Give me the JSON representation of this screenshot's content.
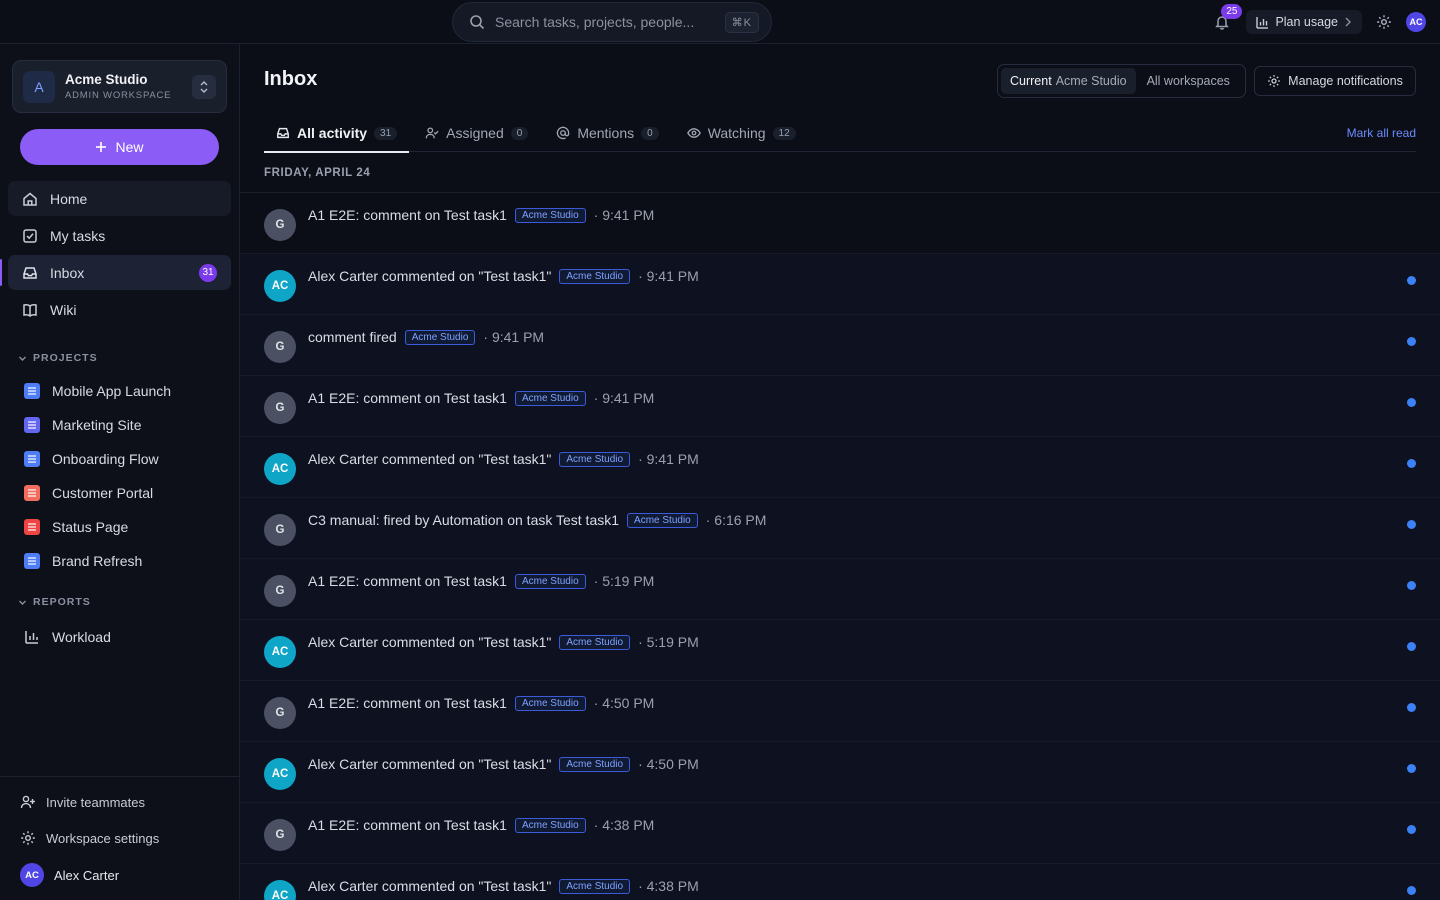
{
  "topbar": {
    "search_placeholder": "Search tasks, projects, people...",
    "search_shortcut": "⌘K",
    "notifications_count": "25",
    "plan_usage_label": "Plan usage",
    "user_initials": "AC"
  },
  "sidebar": {
    "workspace": {
      "initial": "A",
      "name": "Acme Studio",
      "role": "ADMIN WORKSPACE"
    },
    "new_label": "New",
    "nav": [
      {
        "label": "Home",
        "icon": "home-icon"
      },
      {
        "label": "My tasks",
        "icon": "checkbox-icon"
      },
      {
        "label": "Inbox",
        "icon": "inbox-icon",
        "badge": "31"
      },
      {
        "label": "Wiki",
        "icon": "book-icon"
      }
    ],
    "projects_header": "PROJECTS",
    "projects": [
      {
        "label": "Mobile App Launch",
        "color": "#4f7cf7"
      },
      {
        "label": "Marketing Site",
        "color": "#6366f1"
      },
      {
        "label": "Onboarding Flow",
        "color": "#4f7cf7"
      },
      {
        "label": "Customer Portal",
        "color": "#f26d5b"
      },
      {
        "label": "Status Page",
        "color": "#ef4444"
      },
      {
        "label": "Brand Refresh",
        "color": "#4f7cf7"
      }
    ],
    "reports_header": "REPORTS",
    "reports": [
      {
        "label": "Workload"
      }
    ],
    "invite_label": "Invite teammates",
    "settings_label": "Workspace settings",
    "user": {
      "initials": "AC",
      "name": "Alex Carter"
    }
  },
  "main": {
    "title": "Inbox",
    "scope": {
      "current_label": "Current",
      "current_ws": "Acme Studio",
      "all_label": "All workspaces"
    },
    "manage_label": "Manage notifications",
    "tabs": [
      {
        "label": "All activity",
        "count": "31"
      },
      {
        "label": "Assigned",
        "count": "0"
      },
      {
        "label": "Mentions",
        "count": "0"
      },
      {
        "label": "Watching",
        "count": "12"
      }
    ],
    "mark_all_read": "Mark all read",
    "date_header": "FRIDAY, APRIL 24",
    "notifications": [
      {
        "avatar": "G",
        "kind": "g",
        "text": "A1 E2E: comment on Test task1",
        "workspace": "Acme Studio",
        "time": "· 9:41 PM",
        "unread": false
      },
      {
        "avatar": "AC",
        "kind": "ac",
        "text": "Alex Carter commented on \"Test task1\"",
        "workspace": "Acme Studio",
        "time": "· 9:41 PM",
        "unread": true
      },
      {
        "avatar": "G",
        "kind": "g",
        "text": "comment fired",
        "workspace": "Acme Studio",
        "time": "· 9:41 PM",
        "unread": true
      },
      {
        "avatar": "G",
        "kind": "g",
        "text": "A1 E2E: comment on Test task1",
        "workspace": "Acme Studio",
        "time": "· 9:41 PM",
        "unread": true
      },
      {
        "avatar": "AC",
        "kind": "ac",
        "text": "Alex Carter commented on \"Test task1\"",
        "workspace": "Acme Studio",
        "time": "· 9:41 PM",
        "unread": true
      },
      {
        "avatar": "G",
        "kind": "g",
        "text": "C3 manual: fired by Automation on task Test task1",
        "workspace": "Acme Studio",
        "time": "· 6:16 PM",
        "unread": true
      },
      {
        "avatar": "G",
        "kind": "g",
        "text": "A1 E2E: comment on Test task1",
        "workspace": "Acme Studio",
        "time": "· 5:19 PM",
        "unread": true
      },
      {
        "avatar": "AC",
        "kind": "ac",
        "text": "Alex Carter commented on \"Test task1\"",
        "workspace": "Acme Studio",
        "time": "· 5:19 PM",
        "unread": true
      },
      {
        "avatar": "G",
        "kind": "g",
        "text": "A1 E2E: comment on Test task1",
        "workspace": "Acme Studio",
        "time": "· 4:50 PM",
        "unread": true
      },
      {
        "avatar": "AC",
        "kind": "ac",
        "text": "Alex Carter commented on \"Test task1\"",
        "workspace": "Acme Studio",
        "time": "· 4:50 PM",
        "unread": true
      },
      {
        "avatar": "G",
        "kind": "g",
        "text": "A1 E2E: comment on Test task1",
        "workspace": "Acme Studio",
        "time": "· 4:38 PM",
        "unread": true
      },
      {
        "avatar": "AC",
        "kind": "ac",
        "text": "Alex Carter commented on \"Test task1\"",
        "workspace": "Acme Studio",
        "time": "· 4:38 PM",
        "unread": true
      }
    ]
  },
  "colors": {
    "accent": "#8b5cf6",
    "unread_dot": "#3b82f6",
    "chip_text": "#7fa2ff"
  }
}
